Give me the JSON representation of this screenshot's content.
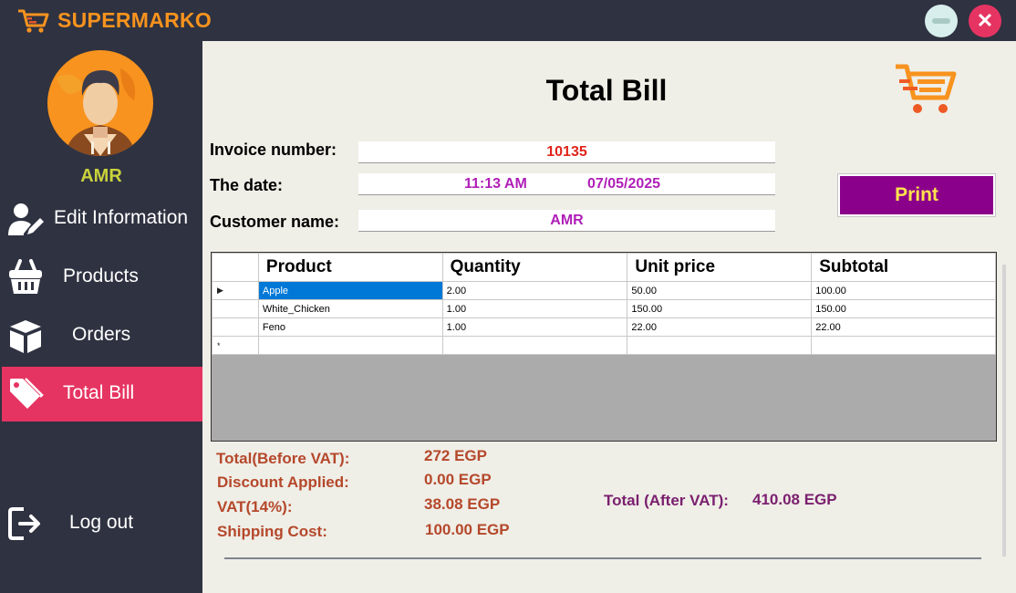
{
  "app": {
    "title": "SUPERMARKO"
  },
  "window": {
    "minimize_icon": "minimize-icon",
    "close_icon": "close-icon",
    "close_glyph": "✕"
  },
  "sidebar": {
    "user_name": "AMR",
    "items": [
      {
        "label": "Edit Information",
        "icon": "user-edit-icon"
      },
      {
        "label": "Products",
        "icon": "basket-icon"
      },
      {
        "label": "Orders",
        "icon": "box-icon"
      },
      {
        "label": "Total Bill",
        "icon": "tag-icon",
        "active": true
      },
      {
        "label": "Log out",
        "icon": "logout-icon"
      }
    ]
  },
  "main": {
    "title": "Total Bill",
    "invoice_label": "Invoice number:",
    "invoice_value": "10135",
    "date_label": "The date:",
    "date_time": "11:13 AM",
    "date_day": "07/05/2025",
    "customer_label": "Customer name:",
    "customer_value": "AMR",
    "print_label": "Print"
  },
  "grid": {
    "columns": [
      "Product",
      "Quantity",
      "Unit price",
      "Subtotal"
    ],
    "rows": [
      [
        "Apple",
        "2.00",
        "50.00",
        "100.00"
      ],
      [
        "White_Chicken",
        "1.00",
        "150.00",
        "150.00"
      ],
      [
        "Feno",
        "1.00",
        "22.00",
        "22.00"
      ]
    ],
    "current_row_marker": "▶",
    "new_row_marker": "*"
  },
  "summary": {
    "before_vat_label": "Total(Before VAT):",
    "before_vat_value": "272 EGP",
    "discount_label": "Discount Applied:",
    "discount_value": "0.00 EGP",
    "vat_label": "VAT(14%):",
    "vat_value": "38.08 EGP",
    "shipping_label": "Shipping Cost:",
    "shipping_value": "100.00 EGP",
    "after_vat_label": "Total (After VAT):",
    "after_vat_value": "410.08 EGP"
  },
  "colors": {
    "sidebar_bg": "#2f3241",
    "accent_active": "#e63462",
    "brand_orange": "#f7931e",
    "print_button": "#8b008b"
  }
}
